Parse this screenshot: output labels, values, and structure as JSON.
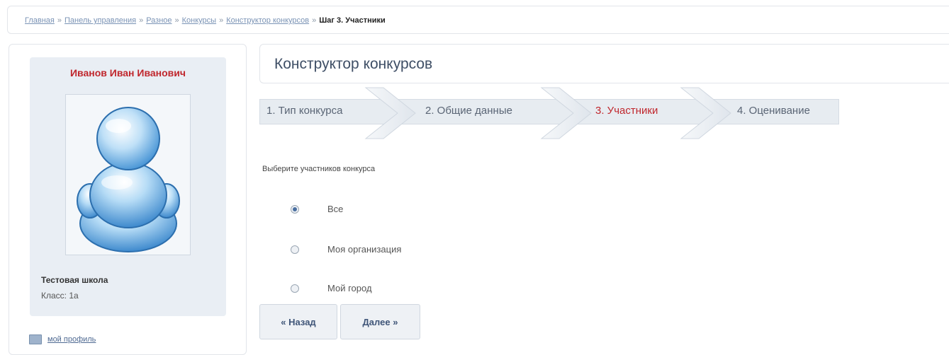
{
  "breadcrumb": {
    "links": [
      "Главная",
      "Панель управления",
      "Разное",
      "Конкурсы",
      "Конструктор конкурсов"
    ],
    "separator": "»",
    "current": "Шаг 3. Участники"
  },
  "profile": {
    "name": "Иванов Иван Иванович",
    "school": "Тестовая школа",
    "class_line": "Класс: 1а",
    "my_profile_link": "мой профиль",
    "name_color": "#c0272d"
  },
  "main": {
    "title": "Конструктор конкурсов",
    "steps": [
      {
        "label": "1. Тип конкурса",
        "active": false
      },
      {
        "label": "2. Общие данные",
        "active": false
      },
      {
        "label": "3. Участники",
        "active": true
      },
      {
        "label": "4. Оценивание",
        "active": false
      }
    ],
    "prompt": "Выберите участников конкурса",
    "options": [
      {
        "label": "Все",
        "selected": true
      },
      {
        "label": "Моя организация",
        "selected": false
      },
      {
        "label": "Мой город",
        "selected": false
      }
    ],
    "back_button": "« Назад",
    "next_button": "Далее »"
  }
}
